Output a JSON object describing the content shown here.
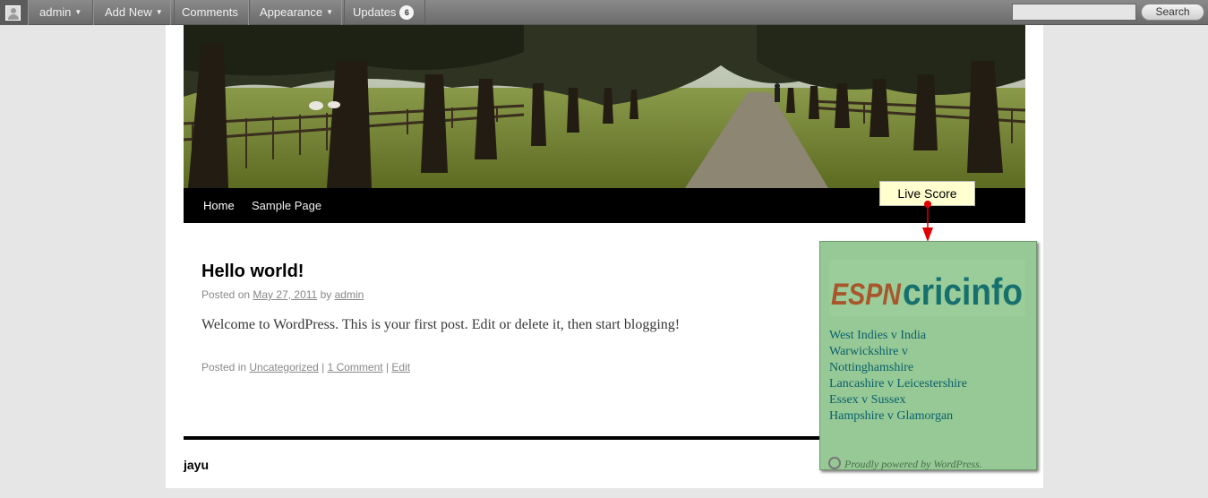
{
  "adminbar": {
    "user": "admin",
    "add_new": "Add New",
    "comments": "Comments",
    "appearance": "Appearance",
    "updates": "Updates",
    "updates_count": "6",
    "search_button": "Search",
    "search_value": ""
  },
  "nav": {
    "items": [
      {
        "label": "Home"
      },
      {
        "label": "Sample Page"
      }
    ]
  },
  "post": {
    "title": "Hello world!",
    "posted_on_label": "Posted on",
    "date": "May 27, 2011",
    "by_label": "by",
    "author": "admin",
    "body": "Welcome to WordPress. This is your first post. Edit or delete it, then start blogging!",
    "posted_in_label": "Posted in",
    "category": "Uncategorized",
    "comments_link": "1 Comment",
    "edit_link": "Edit"
  },
  "footer": {
    "site_name": "jayu",
    "powered_by": "Proudly powered by WordPress."
  },
  "live_score": {
    "label": "Live Score",
    "logo_text_left": "ESPN",
    "logo_text_right": "cricinfo",
    "matches": [
      "West Indies v India",
      "Warwickshire v",
      "Nottinghamshire",
      "Lancashire v Leicestershire",
      "Essex v Sussex",
      "Hampshire v Glamorgan"
    ]
  },
  "colors": {
    "panel_bg": "#96c996",
    "tooltip_bg": "#ffffd0",
    "arrow": "#e00000",
    "link_teal": "#0a5f6a"
  }
}
